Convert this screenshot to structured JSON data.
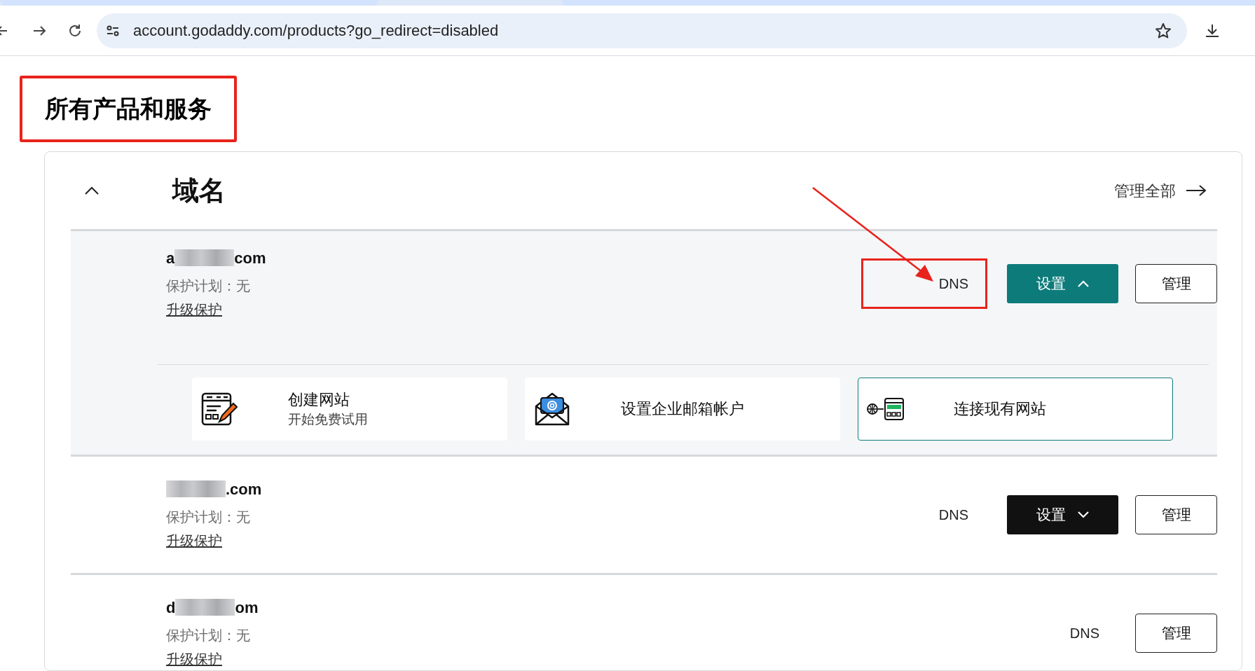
{
  "browser": {
    "url": "account.godaddy.com/products?go_redirect=disabled"
  },
  "page": {
    "title": "所有产品和服务",
    "title_highlighted": true
  },
  "section": {
    "title": "域名",
    "expanded": true,
    "manage_all": "管理全部"
  },
  "domains": [
    {
      "name_start": "a",
      "name_end": "com",
      "redacted": true,
      "protection": "保护计划：无",
      "upgrade": "升级保护",
      "dns": "DNS",
      "dns_highlighted": true,
      "setup": "设置",
      "expanded": true,
      "manage": "管理"
    },
    {
      "name_end": ".com",
      "redacted": true,
      "protection": "保护计划：无",
      "upgrade": "升级保护",
      "dns": "DNS",
      "dns_highlighted": false,
      "setup": "设置",
      "expanded": false,
      "manage": "管理"
    },
    {
      "name_start": "d",
      "name_end": "om",
      "redacted": true,
      "protection": "保护计划：无",
      "upgrade": "升级保护",
      "dns": "DNS",
      "dns_highlighted": false,
      "manage": "管理"
    }
  ],
  "setup_options": [
    {
      "kind": "website",
      "title": "创建网站",
      "subtitle": "开始免费试用",
      "selected": false
    },
    {
      "kind": "email",
      "title": "设置企业邮箱帐户",
      "selected": false
    },
    {
      "kind": "connect",
      "title": "连接现有网站",
      "selected": true
    }
  ]
}
